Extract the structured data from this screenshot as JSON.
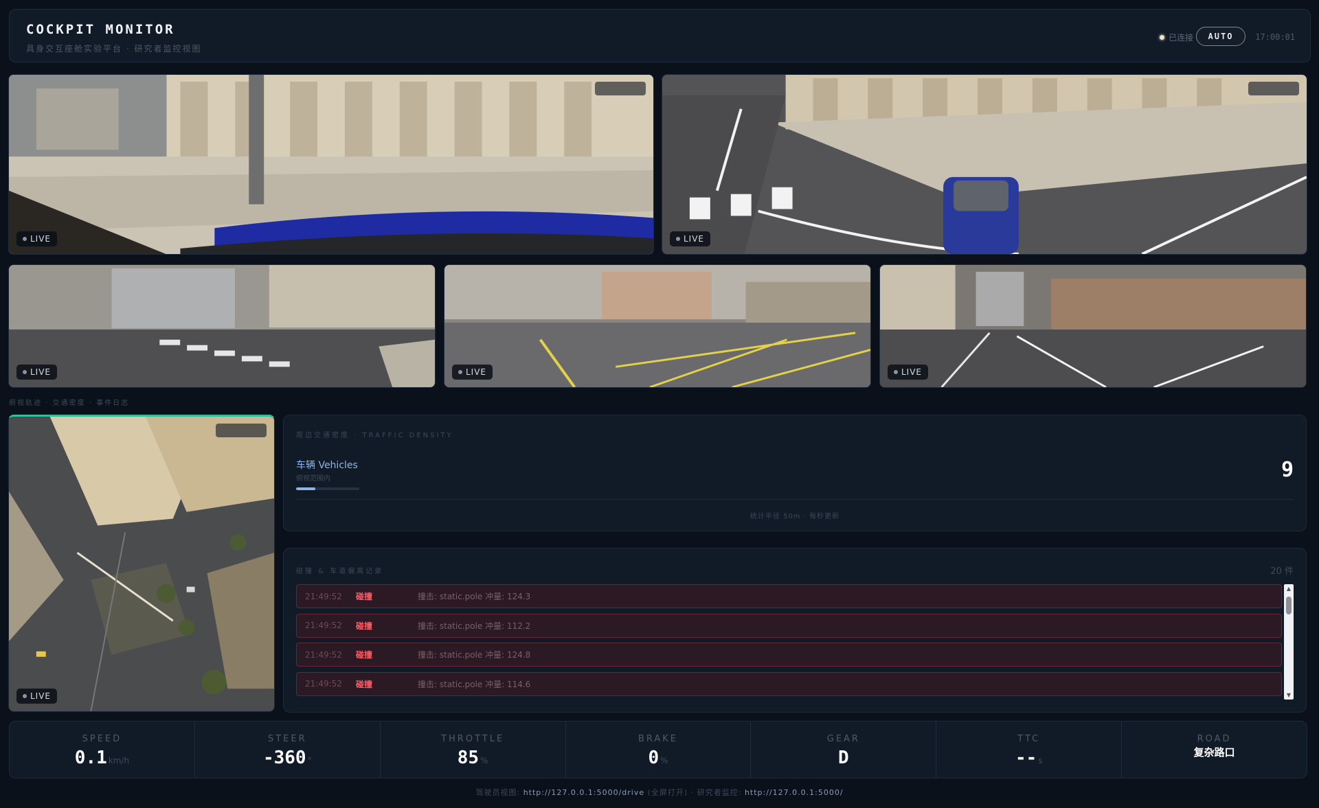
{
  "header": {
    "title": "COCKPIT MONITOR",
    "subtitle": "具身交互座舱实验平台 · 研究者监控视图",
    "status": "已连接",
    "mode_button": "AUTO",
    "clock": "17:00:01"
  },
  "cameras": {
    "live_label": "LIVE"
  },
  "section_crumb": "俯视轨迹 · 交通密度 · 事件日志",
  "density": {
    "heading": "周边交通密度 · TRAFFIC DENSITY",
    "vehicles_label": "车辆 Vehicles",
    "vehicles_sub": "俯视范围内",
    "vehicles_count": "9",
    "vehicles_fill": 0.3,
    "footer": "统计半径 50m · 每秒更新"
  },
  "eventlog": {
    "heading": "碰撞 & 车道偏离记录",
    "count": "20 件",
    "rows": [
      {
        "time": "21:49:52",
        "type": "碰撞",
        "msg": "撞击: static.pole 冲量: 124.3"
      },
      {
        "time": "21:49:52",
        "type": "碰撞",
        "msg": "撞击: static.pole 冲量: 112.2"
      },
      {
        "time": "21:49:52",
        "type": "碰撞",
        "msg": "撞击: static.pole 冲量: 124.8"
      },
      {
        "time": "21:49:52",
        "type": "碰撞",
        "msg": "撞击: static.pole 冲量: 114.6"
      }
    ]
  },
  "telemetry": {
    "speed": {
      "label": "SPEED",
      "value": "0.1",
      "unit": "km/h"
    },
    "steer": {
      "label": "STEER",
      "value": "-360",
      "unit": "°"
    },
    "throttle": {
      "label": "THROTTLE",
      "value": "85",
      "unit": "%"
    },
    "brake": {
      "label": "BRAKE",
      "value": "0",
      "unit": "%"
    },
    "gear": {
      "label": "GEAR",
      "value": "D"
    },
    "ttc": {
      "label": "TTC",
      "value": "--",
      "unit": "s"
    },
    "road": {
      "label": "ROAD",
      "value": "复杂路口"
    }
  },
  "footer": {
    "driver_label": "驾驶员视图:",
    "driver_url": "http://127.0.0.1:5000/drive",
    "driver_note": "(全屏打开)",
    "sep": "·",
    "researcher_label": "研究者监控:",
    "researcher_url": "http://127.0.0.1:5000/"
  },
  "colors": {
    "background": "#0b111b",
    "panel": "#111a27",
    "accent_blue": "#8fb4e6",
    "collision_red": "#ff5c66",
    "minimap_accent": "#2fbf9a"
  }
}
